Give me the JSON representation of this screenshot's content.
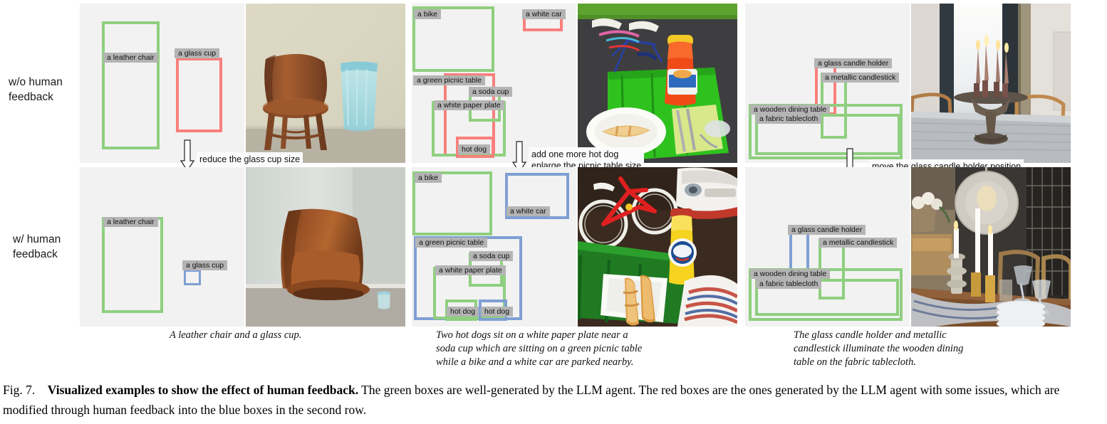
{
  "figure": {
    "number": "Fig. 7.",
    "title": "Visualized examples to show the effect of human feedback.",
    "body": " The green boxes are well-generated by the LLM agent. The red boxes are the ones generated by the LLM agent with some issues, which are modified through human feedback into the blue boxes in the second row."
  },
  "row_labels": {
    "without_feedback": "w/o human\nfeedback",
    "with_feedback": "w/ human\nfeedback"
  },
  "colors": {
    "green": "#8fcf7f",
    "red": "#f9807c",
    "blue": "#7f9fd4",
    "canvas": "#f2f2f2",
    "label_bg": "#b4b4b4"
  },
  "panels": [
    {
      "id": "panel-chair",
      "prompt": "A leather chair and a glass cup.",
      "feedback": "reduce the glass cup size",
      "photo_top_alt": "brown leather chair beside a large glass cup",
      "photo_bottom_alt": "brown leather armchair with a small glass cup on carpet",
      "top_boxes": [
        {
          "label": "a leather chair",
          "color": "green"
        },
        {
          "label": "a glass cup",
          "color": "red"
        }
      ],
      "bottom_boxes": [
        {
          "label": "a leather chair",
          "color": "green"
        },
        {
          "label": "a glass cup",
          "color": "blue"
        }
      ]
    },
    {
      "id": "panel-hotdog",
      "prompt": "Two hot dogs sit on a white paper plate near a\nsoda cup which are sitting on a green picnic table\nwhile a bike and a white car are parked nearby.",
      "feedback": "add one more hot dog\nenlarge the picnic table size\nenlarge the car box size",
      "photo_top_alt": "bicycle and orange bottle on a green picnic table with a hot dog on a white plate",
      "photo_bottom_alt": "red bicycle, white car, yellow bottle and two hot dogs on a white plate on a green picnic table",
      "top_boxes": [
        {
          "label": "a bike",
          "color": "green"
        },
        {
          "label": "a white car",
          "color": "red"
        },
        {
          "label": "a green picnic table",
          "color": "red"
        },
        {
          "label": "a soda cup",
          "color": "green"
        },
        {
          "label": "a white paper plate",
          "color": "green"
        },
        {
          "label": "hot dog",
          "color": "red"
        }
      ],
      "bottom_boxes": [
        {
          "label": "a bike",
          "color": "green"
        },
        {
          "label": "a white car",
          "color": "blue"
        },
        {
          "label": "a green picnic table",
          "color": "blue"
        },
        {
          "label": "a soda cup",
          "color": "green"
        },
        {
          "label": "a white paper plate",
          "color": "green"
        },
        {
          "label": "hot dog",
          "color": "green"
        },
        {
          "label": "hot dog",
          "color": "blue"
        }
      ]
    },
    {
      "id": "panel-candle",
      "prompt": "The glass candle holder and metallic\ncandlestick illuminate the wooden dining\ntable on the fabric tablecloth.",
      "feedback": "move the glass candle holder position",
      "photo_top_alt": "ornate metal candle holder with lit candles on a dining table",
      "photo_bottom_alt": "dining table with candlesticks, glassware and a large woven pendant lamp",
      "top_boxes": [
        {
          "label": "a glass candle holder",
          "color": "red"
        },
        {
          "label": "a metallic candlestick",
          "color": "green"
        },
        {
          "label": "a wooden dining table",
          "color": "green"
        },
        {
          "label": "a fabric tablecloth",
          "color": "green"
        }
      ],
      "bottom_boxes": [
        {
          "label": "a glass candle holder",
          "color": "blue"
        },
        {
          "label": "a metallic candlestick",
          "color": "green"
        },
        {
          "label": "a wooden dining table",
          "color": "green"
        },
        {
          "label": "a fabric tablecloth",
          "color": "green"
        }
      ]
    }
  ]
}
